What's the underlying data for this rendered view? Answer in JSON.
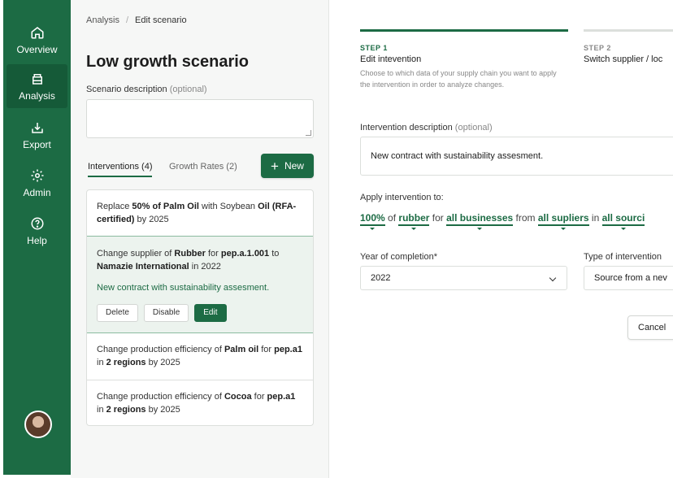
{
  "sidebar": {
    "items": [
      {
        "label": "Overview",
        "icon": "home-icon"
      },
      {
        "label": "Analysis",
        "icon": "layers-icon"
      },
      {
        "label": "Export",
        "icon": "download-icon"
      },
      {
        "label": "Admin",
        "icon": "gear-icon"
      },
      {
        "label": "Help",
        "icon": "question-icon"
      }
    ]
  },
  "breadcrumb": {
    "parent": "Analysis",
    "current": "Edit scenario"
  },
  "scenario": {
    "title": "Low growth scenario",
    "description_label": "Scenario description",
    "description_optional": "(optional)",
    "description_value": ""
  },
  "tabs": {
    "interventions": "Interventions (4)",
    "growth_rates": "Growth Rates (2)",
    "new_label": "New"
  },
  "interventions": [
    {
      "parts": [
        "Replace ",
        "50% of Palm Oil",
        " with Soybean ",
        "Oil",
        " ",
        "(RFA-certified)",
        " by 2025"
      ]
    },
    {
      "parts": [
        "Change supplier of ",
        "Rubber",
        " for ",
        "pep.a.1.001",
        " to ",
        "Namazie International",
        " in 2022"
      ],
      "note": "New contract with sustainability assesment.",
      "actions": {
        "delete": "Delete",
        "disable": "Disable",
        "edit": "Edit"
      }
    },
    {
      "parts": [
        "Change production efficiency of ",
        "Palm oil",
        " for ",
        "pep.a1",
        " in ",
        "2 regions",
        " by 2025"
      ]
    },
    {
      "parts": [
        "Change production efficiency of ",
        "Cocoa",
        " for ",
        "pep.a1",
        " in ",
        "2 regions",
        " by 2025"
      ]
    }
  ],
  "steps": [
    {
      "label": "STEP 1",
      "title": "Edit intevention",
      "desc": "Choose to which data of your supply chain you want to apply the intervention in order to analyze changes."
    },
    {
      "label": "STEP 2",
      "title": "Switch supplier / loc"
    }
  ],
  "form": {
    "intervention_desc_label": "Intervention description",
    "intervention_desc_optional": "(optional)",
    "intervention_desc_value": "New contract with sustainability assesment.",
    "apply_label": "Apply intervention to:",
    "apply": {
      "percent": "100%",
      "of": "of",
      "material": "rubber",
      "for": "for",
      "businesses": "all businesses",
      "from": "from",
      "suppliers": "all supliers",
      "in": "in",
      "sources": "all sourci"
    },
    "year_label": "Year of completion*",
    "year_value": "2022",
    "type_label": "Type of intervention",
    "type_value": "Source from a nev",
    "cancel_label": "Cancel"
  },
  "colors": {
    "brand": "#1c6b44",
    "brand_dark": "#155a38"
  }
}
